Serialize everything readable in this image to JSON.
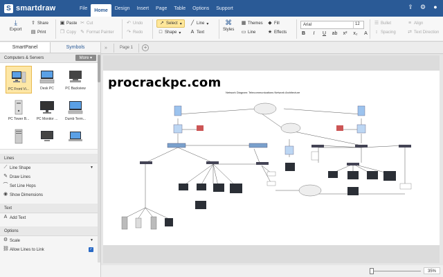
{
  "app": {
    "name": "smartdraw",
    "logo_letter": "S"
  },
  "menu": [
    "File",
    "Home",
    "Design",
    "Insert",
    "Page",
    "Table",
    "Options",
    "Support"
  ],
  "menu_active": "Home",
  "ribbon": {
    "export": "Export",
    "share": "Share",
    "print": "Print",
    "paste": "Paste",
    "cut": "Cut",
    "copy": "Copy",
    "format_painter": "Format Painter",
    "undo": "Undo",
    "redo": "Redo",
    "select": "Select",
    "shape": "Shape",
    "line": "Line",
    "text": "Text",
    "styles": "Styles",
    "themes": "Themes",
    "fill": "Fill",
    "line2": "Line",
    "effects": "Effects",
    "font": "Arial",
    "font_size": "12",
    "bullet": "Bullet",
    "align": "Align",
    "spacing": "Spacing",
    "text_direction": "Text Direction"
  },
  "left_panel": {
    "tabs": [
      "SmartPanel",
      "Symbols"
    ],
    "library": "Computers & Servers",
    "more": "More",
    "shapes": [
      "PC Front Vi...",
      "Desk PC",
      "PC Backview",
      "PC Tower B...",
      "PC Monitor ...",
      "Dumb Term...",
      "",
      "",
      ""
    ],
    "lines_head": "Lines",
    "lines_items": [
      "Line Shape",
      "Draw Lines",
      "Set Line Hops",
      "Show Dimensions"
    ],
    "text_head": "Text",
    "text_items": [
      "Add Text"
    ],
    "options_head": "Options",
    "options_items": [
      "Scale",
      "Allow Lines to Link"
    ]
  },
  "doc_tabs": {
    "page": "Page 1"
  },
  "canvas": {
    "watermark": "procrackpc.com",
    "diagram_title": "Network Diagram: Telecommunications Network Architecture"
  },
  "status": {
    "zoom": "35%"
  },
  "colors": {
    "brand": "#2a5a96",
    "selected": "#fde7a6"
  }
}
